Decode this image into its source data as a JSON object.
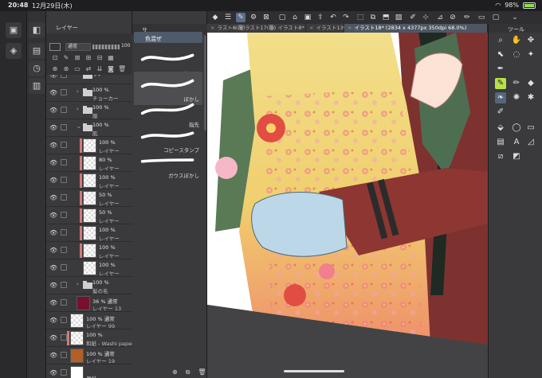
{
  "status_bar": {
    "time": "20:48",
    "date": "12月29日(木)",
    "battery": "98%",
    "battery_level": 0.98
  },
  "layer_panel": {
    "tab_label": "レイヤー",
    "blend_mode": "通常",
    "opacity": "100",
    "layers": [
      {
        "type": "folder",
        "line1": "ラノ",
        "line2": "",
        "indent": 1
      },
      {
        "type": "folder",
        "line1": "100 %",
        "line2": "チョーカー",
        "indent": 1
      },
      {
        "type": "folder",
        "line1": "100 %",
        "line2": "服",
        "indent": 1
      },
      {
        "type": "folder",
        "line1": "100 %",
        "line2": "肌",
        "indent": 1,
        "open": true
      },
      {
        "type": "layer",
        "line1": "100 %",
        "line2": "レイヤー",
        "indent": 2,
        "mask": true
      },
      {
        "type": "layer",
        "line1": "80 %",
        "line2": "レイヤー",
        "indent": 2,
        "mask": true
      },
      {
        "type": "layer",
        "line1": "100 %",
        "line2": "レイヤー",
        "indent": 2,
        "mask": true
      },
      {
        "type": "layer",
        "line1": "50 %",
        "line2": "レイヤー",
        "indent": 2,
        "mask": true
      },
      {
        "type": "layer",
        "line1": "50 %",
        "line2": "レイヤー",
        "indent": 2,
        "mask": true
      },
      {
        "type": "layer",
        "line1": "100 %",
        "line2": "レイヤー",
        "indent": 2,
        "mask": true
      },
      {
        "type": "layer",
        "line1": "100 %",
        "line2": "レイヤー",
        "indent": 2,
        "mask": true
      },
      {
        "type": "layer",
        "line1": "100 %",
        "line2": "レイヤー",
        "indent": 2
      },
      {
        "type": "folder",
        "line1": "100 %",
        "line2": "髪の毛",
        "indent": 1
      },
      {
        "type": "layer",
        "line1": "36 % 通常",
        "line2": "レイヤー 13",
        "indent": 1,
        "thumb": "#7a1030"
      },
      {
        "type": "layer",
        "line1": "100 % 通常",
        "line2": "レイヤー 99",
        "indent": 0
      },
      {
        "type": "layer",
        "line1": "100 %",
        "line2": "和紙 - Washi paper",
        "indent": 0,
        "mask": true
      },
      {
        "type": "layer",
        "line1": "100 % 通常",
        "line2": "レイヤー 19",
        "indent": 0,
        "thumb": "#b35f25"
      },
      {
        "type": "layer",
        "line1": "",
        "line2": "用紙",
        "indent": 0,
        "thumb": "#ffffff"
      }
    ]
  },
  "sub_tool_panel": {
    "tab_label": "サ",
    "group_label": "色混ぜ",
    "brushes": [
      {
        "name": "色混ぜ"
      },
      {
        "name": "ぼかし",
        "selected": true
      },
      {
        "name": "指先"
      },
      {
        "name": "コピースタンプ"
      },
      {
        "name": "ガウスぼかし"
      }
    ]
  },
  "document_tabs": [
    {
      "label": "ラスト6(覆)"
    },
    {
      "label": "イラスト17(覆)"
    },
    {
      "label": "イラスト8*"
    },
    {
      "label": "イラスト13*"
    },
    {
      "label": "イラスト18* (2834 x 4377px 350dpi 68.0%)",
      "active": true
    }
  ],
  "tool_panel": {
    "title": "ツール"
  }
}
